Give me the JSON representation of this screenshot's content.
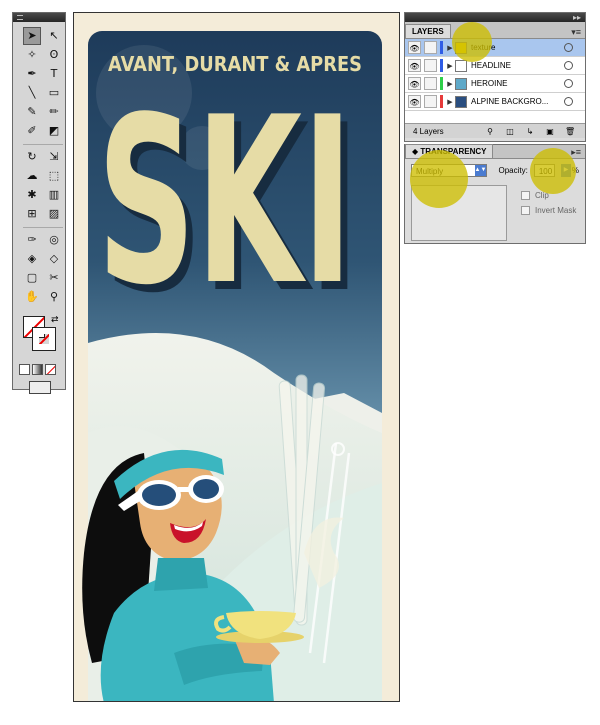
{
  "tools_panel": {
    "tools": [
      {
        "icon": "selection-arrow",
        "glyph": "➤",
        "selected": true
      },
      {
        "icon": "direct-selection-arrow",
        "glyph": "↖"
      },
      {
        "icon": "magic-wand",
        "glyph": "✧"
      },
      {
        "icon": "lasso",
        "glyph": "ʘ"
      },
      {
        "icon": "pen",
        "glyph": "✒"
      },
      {
        "icon": "type",
        "glyph": "T"
      },
      {
        "icon": "line",
        "glyph": "╲"
      },
      {
        "icon": "rectangle",
        "glyph": "▭"
      },
      {
        "icon": "paintbrush",
        "glyph": "✎"
      },
      {
        "icon": "pencil",
        "glyph": "✏"
      },
      {
        "icon": "blob-brush",
        "glyph": "✐"
      },
      {
        "icon": "eraser",
        "glyph": "◩"
      },
      {
        "icon": "rotate",
        "glyph": "↻"
      },
      {
        "icon": "scale",
        "glyph": "⇲"
      },
      {
        "icon": "warp",
        "glyph": "☁"
      },
      {
        "icon": "free-transform",
        "glyph": "⬚"
      },
      {
        "icon": "symbol-sprayer",
        "glyph": "✱"
      },
      {
        "icon": "column-graph",
        "glyph": "▥"
      },
      {
        "icon": "mesh",
        "glyph": "⊞"
      },
      {
        "icon": "gradient",
        "glyph": "▨"
      },
      {
        "icon": "eyedropper",
        "glyph": "✑"
      },
      {
        "icon": "blend",
        "glyph": "◎"
      },
      {
        "icon": "live-paint-bucket",
        "glyph": "◈"
      },
      {
        "icon": "live-paint-selection",
        "glyph": "◇"
      },
      {
        "icon": "artboard",
        "glyph": "▢"
      },
      {
        "icon": "slice",
        "glyph": "✂"
      },
      {
        "icon": "hand",
        "glyph": "✋"
      },
      {
        "icon": "zoom",
        "glyph": "⚲"
      }
    ]
  },
  "poster": {
    "tagline": "AVANT, DURANT & APRES",
    "headline": "SKI",
    "colors": {
      "sky_top": "#1f3d5c",
      "sky_bottom": "#5d8aa7",
      "headline": "#e6dca6",
      "turquoise": "#3bb6c0",
      "paper": "#f4ecd9"
    }
  },
  "layers_panel": {
    "tab": "LAYERS",
    "layers": [
      {
        "name": "texture",
        "color": "#2f5ce6",
        "thumb": "#f2d400",
        "selected": true
      },
      {
        "name": "HEADLINE",
        "color": "#2f5ce6",
        "thumb": "#ffffff",
        "selected": false
      },
      {
        "name": "HEROINE",
        "color": "#2fcf4a",
        "thumb": "#5fa9c9",
        "selected": false
      },
      {
        "name": "ALPINE BACKGRO...",
        "color": "#e63a3a",
        "thumb": "#2a4e80",
        "selected": false
      }
    ],
    "count_label": "4 Layers"
  },
  "transparency_panel": {
    "tab": "TRANSPARENCY",
    "blend_mode": "Multiply",
    "opacity_label": "Opacity:",
    "opacity_value": "100",
    "percent": "%",
    "clip_label": "Clip",
    "invert_mask_label": "Invert Mask"
  },
  "annotations": {
    "highlight_color": "#cdbd00"
  }
}
